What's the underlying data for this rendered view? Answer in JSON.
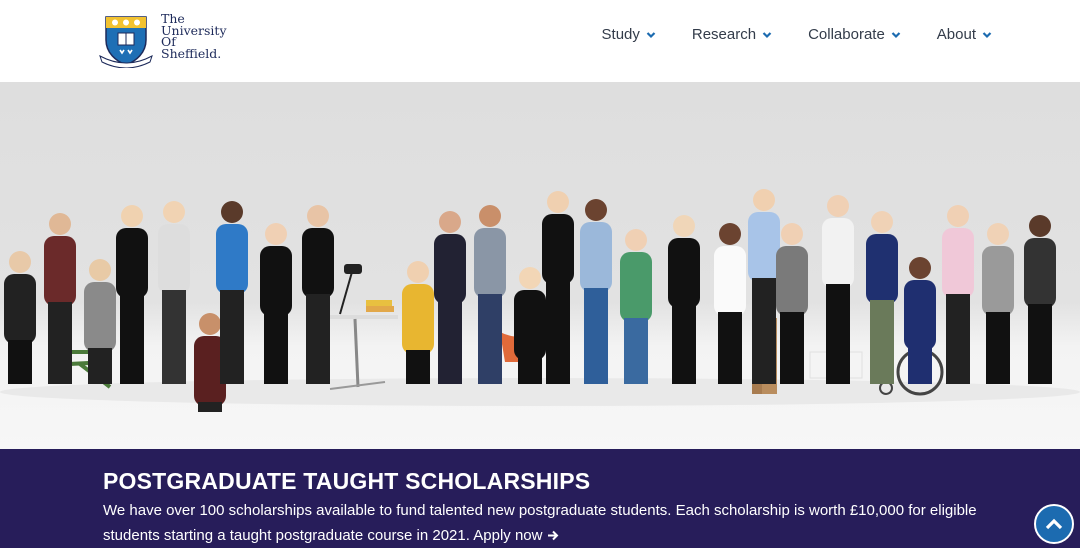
{
  "logo": {
    "line1": "The",
    "line2": "University",
    "line3": "Of",
    "line4": "Sheffield."
  },
  "nav": {
    "items": [
      {
        "label": "Study"
      },
      {
        "label": "Research"
      },
      {
        "label": "Collaborate"
      },
      {
        "label": "About"
      }
    ]
  },
  "banner": {
    "title": "POSTGRADUATE TAUGHT SCHOLARSHIPS",
    "text": "We have over 100 scholarships available to fund talented new postgraduate students. Each scholarship is worth £10,000 for eligible students starting a taught postgraduate course in 2021.",
    "link": "Apply now"
  },
  "colors": {
    "brand_dark": "#271d5a",
    "accent_blue": "#1c6bb0",
    "nav_text": "#333c4a"
  },
  "icons": {
    "nav_chevron": "chevron-down-icon",
    "link_arrow": "arrow-right-icon",
    "scroll": "chevron-up-icon"
  }
}
